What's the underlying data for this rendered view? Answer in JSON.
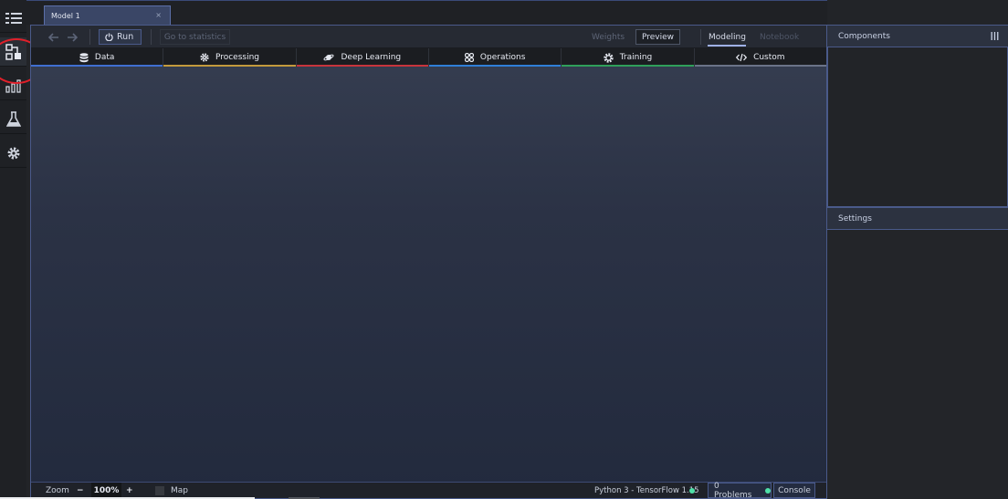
{
  "tab": {
    "title": "Model 1",
    "close": "×"
  },
  "toolbar": {
    "run_label": "Run",
    "stats_label": "Go to statistics",
    "weights_label": "Weights",
    "preview_label": "Preview",
    "modeling_label": "Modeling",
    "notebook_label": "Notebook"
  },
  "categories": [
    {
      "label": "Data",
      "icon": "database-icon",
      "color": "#3f6fd1"
    },
    {
      "label": "Processing",
      "icon": "gear-icon",
      "color": "#c39a3c"
    },
    {
      "label": "Deep Learning",
      "icon": "planet-icon",
      "color": "#c8343c"
    },
    {
      "label": "Operations",
      "icon": "grid-dots-icon",
      "color": "#2f7fd8"
    },
    {
      "label": "Training",
      "icon": "cog-icon",
      "color": "#2fa05a"
    },
    {
      "label": "Custom",
      "icon": "code-icon",
      "color": "#6b7388"
    }
  ],
  "status": {
    "zoom_label": "Zoom",
    "zoom_minus": "−",
    "zoom_value": "100%",
    "zoom_plus": "+",
    "map_label": "Map",
    "python_label": "Python 3 - TensorFlow 1.15",
    "problems_label": "0 Problems",
    "console_label": "Console"
  },
  "panels": {
    "components_title": "Components",
    "settings_title": "Settings"
  },
  "sidebar": {
    "icons": [
      "list-icon",
      "model-hub-icon",
      "chart-bars-icon",
      "flask-icon",
      "settings-gear-icon"
    ]
  },
  "colors": {
    "accent": "#4a5a8a",
    "status_ok": "#4fe0a8",
    "annotation": "#e0202a"
  }
}
